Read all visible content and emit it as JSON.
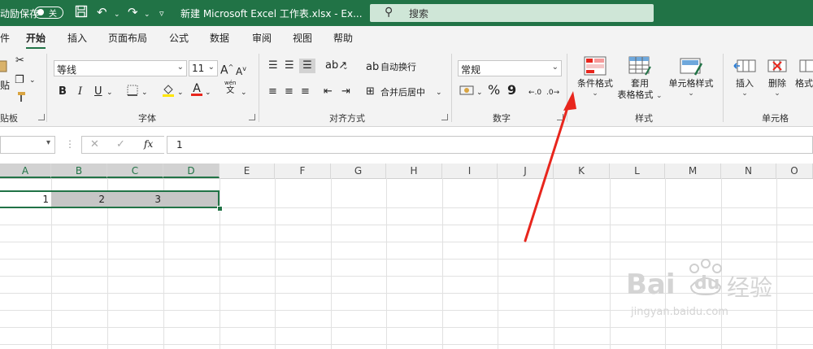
{
  "titlebar": {
    "autosave_label": "动励保存",
    "autosave_state": "关",
    "doc_title": "新建 Microsoft Excel 工作表.xlsx  -  Ex...",
    "search_placeholder": "搜索"
  },
  "menu": {
    "tabs": [
      "件",
      "开始",
      "插入",
      "页面布局",
      "公式",
      "数据",
      "审阅",
      "视图",
      "帮助"
    ],
    "active_tab": "开始"
  },
  "ribbon": {
    "clipboard": {
      "paste_label": "贴",
      "group_label": "贴板"
    },
    "font": {
      "font_name": "等线",
      "font_size": "11",
      "grow": "A",
      "shrink": "A",
      "bold": "B",
      "italic": "I",
      "underline": "U",
      "phonetic_top": "wén",
      "phonetic_bottom": "文",
      "group_label": "字体"
    },
    "alignment": {
      "wrap_text": "自动换行",
      "merge_center": "合并后居中",
      "group_label": "对齐方式"
    },
    "number": {
      "format": "常规",
      "percent": "%",
      "comma": "9",
      "group_label": "数字"
    },
    "styles": {
      "conditional": "条件格式",
      "table_format_1": "套用",
      "table_format_2": "表格格式",
      "cell_styles": "单元格样式",
      "group_label": "样式"
    },
    "cells": {
      "insert": "插入",
      "delete": "删除",
      "format": "格式",
      "group_label": "单元格"
    }
  },
  "formula_bar": {
    "fx": "fx",
    "value": "1"
  },
  "columns": [
    "A",
    "B",
    "C",
    "D",
    "E",
    "F",
    "G",
    "H",
    "I",
    "J",
    "K",
    "L",
    "M",
    "N",
    "O"
  ],
  "selected_columns": [
    "A",
    "B",
    "C",
    "D"
  ],
  "row1": {
    "A": "1",
    "B": "2",
    "C": "3"
  },
  "watermark": {
    "brand": "Bai",
    "brand2": "du",
    "cn": "经验",
    "url": "jingyan.baidu.com"
  },
  "colors": {
    "excel_green": "#217346",
    "annotation_red": "#e8261d",
    "selection_gray": "#c6c6c6"
  }
}
